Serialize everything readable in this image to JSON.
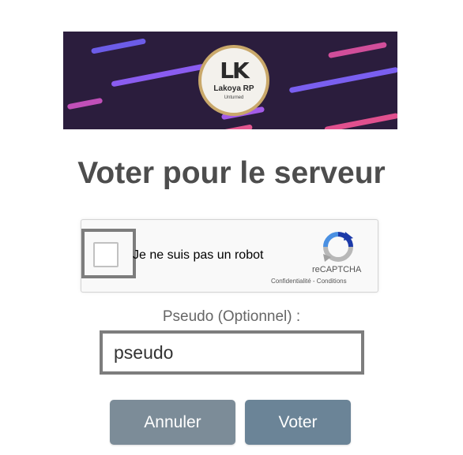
{
  "banner": {
    "logo_mark": "LK",
    "logo_name": "Lakoya RP",
    "logo_sub": "Unturned"
  },
  "page_title": "Voter pour le serveur",
  "captcha": {
    "label": "Je ne suis pas un robot",
    "brand": "reCAPTCHA",
    "links": "Confidentialité - Conditions"
  },
  "form": {
    "pseudo_label": "Pseudo (Optionnel) :",
    "pseudo_value": "pseudo"
  },
  "buttons": {
    "cancel_label": "Annuler",
    "vote_label": "Voter"
  },
  "colors": {
    "banner_bg": "#2b1d3d",
    "button_cancel": "#7c8c98",
    "button_vote": "#6b8497",
    "title": "#4d4d4d"
  }
}
